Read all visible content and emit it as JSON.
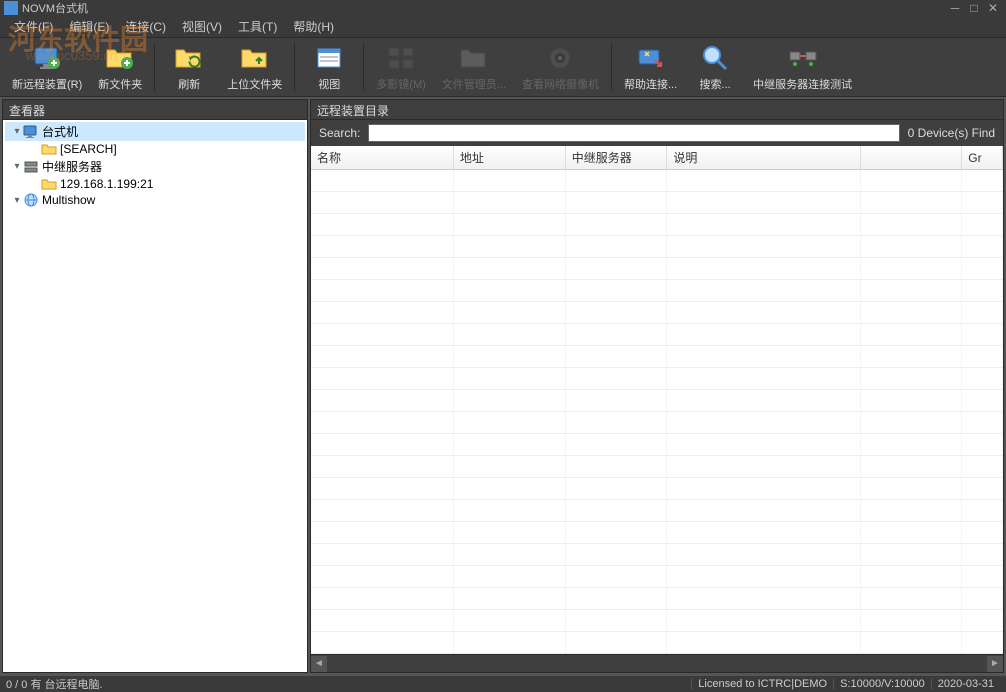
{
  "title": "NOVM台式机",
  "watermark": {
    "main": "河东软件园",
    "sub": "www.pc0359.cn"
  },
  "menu": {
    "file": "文件(F)",
    "edit": "编辑(E)",
    "connect": "连接(C)",
    "view": "视图(V)",
    "tools": "工具(T)",
    "help": "帮助(H)"
  },
  "toolbar": {
    "new_remote": "新远程装置(R)",
    "new_folder": "新文件夹",
    "refresh": "刷新",
    "parent_folder": "上位文件夹",
    "view": "视图",
    "multi_cast": "多影镜(M)",
    "file_manager": "文件管理员...",
    "view_ipcam": "查看网络摄像机",
    "help_connect": "帮助连接...",
    "search": "搜索...",
    "relay_test": "中继服务器连接测试"
  },
  "left": {
    "header": "查看器",
    "items": [
      {
        "label": "台式机",
        "type": "monitor",
        "indent": 0,
        "selected": true
      },
      {
        "label": "[SEARCH]",
        "type": "folder",
        "indent": 1
      },
      {
        "label": "中继服务器",
        "type": "server",
        "indent": 0
      },
      {
        "label": "129.168.1.199:21",
        "type": "folder",
        "indent": 1
      },
      {
        "label": "Multishow",
        "type": "globe",
        "indent": 0
      }
    ]
  },
  "right": {
    "header": "远程装置目录",
    "search_label": "Search:",
    "search_value": "",
    "count_label": "0 Device(s) Find",
    "columns": {
      "name": "名称",
      "address": "地址",
      "relay": "中继服务器",
      "desc": "说明",
      "empty": "",
      "group": "Gr"
    }
  },
  "status": {
    "left": "0 / 0 有   台远程电脑.",
    "license": "Licensed to ICTRC|DEMO",
    "version": "S:10000/V:10000",
    "date": "2020-03-31"
  }
}
